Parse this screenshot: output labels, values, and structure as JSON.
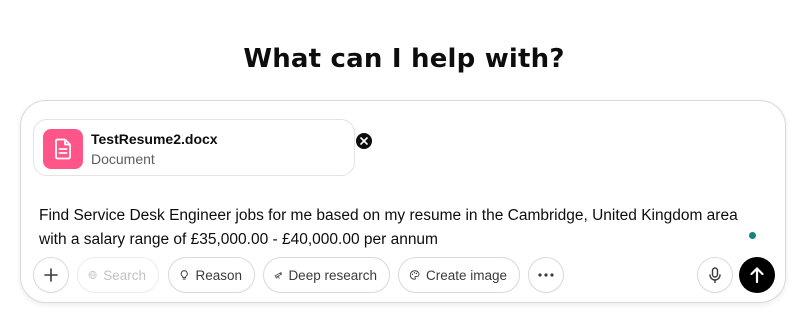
{
  "header": {
    "title": "What can I help with?"
  },
  "attachment": {
    "file_name": "TestResume2.docx",
    "file_type": "Document",
    "icon": "document-icon",
    "icon_color": "#ff5588"
  },
  "prompt": {
    "text": "Find Service Desk Engineer jobs for me based on my resume in the Cambridge, United Kingdom area with a salary range of  £35,000.00 - £40,000.00 per annum"
  },
  "toolbar": {
    "add_icon": "plus-icon",
    "search_label": "Search",
    "search_icon": "globe-icon",
    "reason_label": "Reason",
    "reason_icon": "lightbulb-icon",
    "deep_research_label": "Deep research",
    "deep_research_icon": "telescope-icon",
    "create_image_label": "Create image",
    "create_image_icon": "paint-icon",
    "more_icon": "ellipsis-icon",
    "mic_icon": "microphone-icon",
    "send_icon": "arrow-up-icon"
  },
  "colors": {
    "accent_dot": "#10847e",
    "send_button": "#000000"
  }
}
